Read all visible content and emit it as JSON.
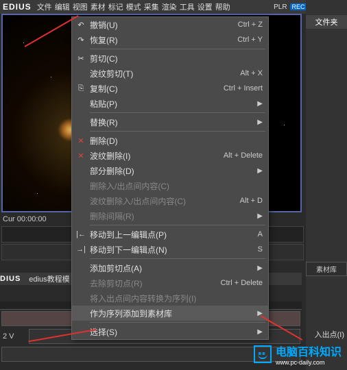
{
  "topbar": {
    "logo": "EDIUS",
    "menus": [
      "文件",
      "编辑",
      "视图",
      "素材",
      "标记",
      "模式",
      "采集",
      "渲染",
      "工具",
      "设置",
      "帮助"
    ],
    "plr": "PLR",
    "rec": "REC"
  },
  "right": {
    "title": "文件夹",
    "lib_tab": "素材库"
  },
  "timecode_prefix": "Cur",
  "timecode": "00:00:00",
  "ctx": {
    "items": [
      {
        "icon": "↶",
        "label": "撤销(U)",
        "shortcut": "Ctrl + Z",
        "enabled": true
      },
      {
        "icon": "↷",
        "label": "恢复(R)",
        "shortcut": "Ctrl + Y",
        "enabled": true
      },
      {
        "sep": true
      },
      {
        "icon": "✂",
        "label": "剪切(C)",
        "shortcut": "",
        "enabled": true
      },
      {
        "icon": "",
        "label": "波纹剪切(T)",
        "shortcut": "Alt + X",
        "enabled": true
      },
      {
        "icon": "⎘",
        "label": "复制(C)",
        "shortcut": "Ctrl + Insert",
        "enabled": true
      },
      {
        "icon": "",
        "label": "粘贴(P)",
        "shortcut": "",
        "enabled": true,
        "sub": true
      },
      {
        "sep": true
      },
      {
        "icon": "",
        "label": "替换(R)",
        "shortcut": "",
        "enabled": true,
        "sub": true
      },
      {
        "sep": true
      },
      {
        "icon": "✕",
        "label": "删除(D)",
        "shortcut": "",
        "enabled": true
      },
      {
        "icon": "✕",
        "label": "波纹删除(I)",
        "shortcut": "Alt + Delete",
        "enabled": true
      },
      {
        "icon": "",
        "label": "部分删除(D)",
        "shortcut": "",
        "enabled": true,
        "sub": true
      },
      {
        "icon": "",
        "label": "删除入/出点间内容(C)",
        "shortcut": "",
        "enabled": false
      },
      {
        "icon": "",
        "label": "波纹删除入/出点间内容(C)",
        "shortcut": "Alt + D",
        "enabled": false
      },
      {
        "icon": "",
        "label": "删除间隔(R)",
        "shortcut": "",
        "enabled": false,
        "sub": true
      },
      {
        "sep": true
      },
      {
        "icon": "↤",
        "label": "移动到上一编辑点(P)",
        "shortcut": "A",
        "enabled": true
      },
      {
        "icon": "↦",
        "label": "移动到下一编辑点(N)",
        "shortcut": "S",
        "enabled": true
      },
      {
        "sep": true
      },
      {
        "icon": "",
        "label": "添加剪切点(A)",
        "shortcut": "",
        "enabled": true,
        "sub": true
      },
      {
        "icon": "",
        "label": "去除剪切点(R)",
        "shortcut": "Ctrl + Delete",
        "enabled": false
      },
      {
        "icon": "",
        "label": "将入出点间内容转换为序列(I)",
        "shortcut": "",
        "enabled": false
      },
      {
        "icon": "",
        "label": "作为序列添加到素材库",
        "shortcut": "",
        "enabled": true,
        "highlight": true,
        "sub": true
      },
      {
        "sep": true
      },
      {
        "icon": "",
        "label": "选择(S)",
        "shortcut": "",
        "enabled": true,
        "sub": true
      }
    ]
  },
  "submenu_hint": "入出点(I)",
  "second_bar": {
    "logo": "DIUS",
    "project": "edius教程模"
  },
  "track_label": "2 V",
  "footer": {
    "brand": "电脑百科知识",
    "url": "www.pc-daily.com"
  }
}
